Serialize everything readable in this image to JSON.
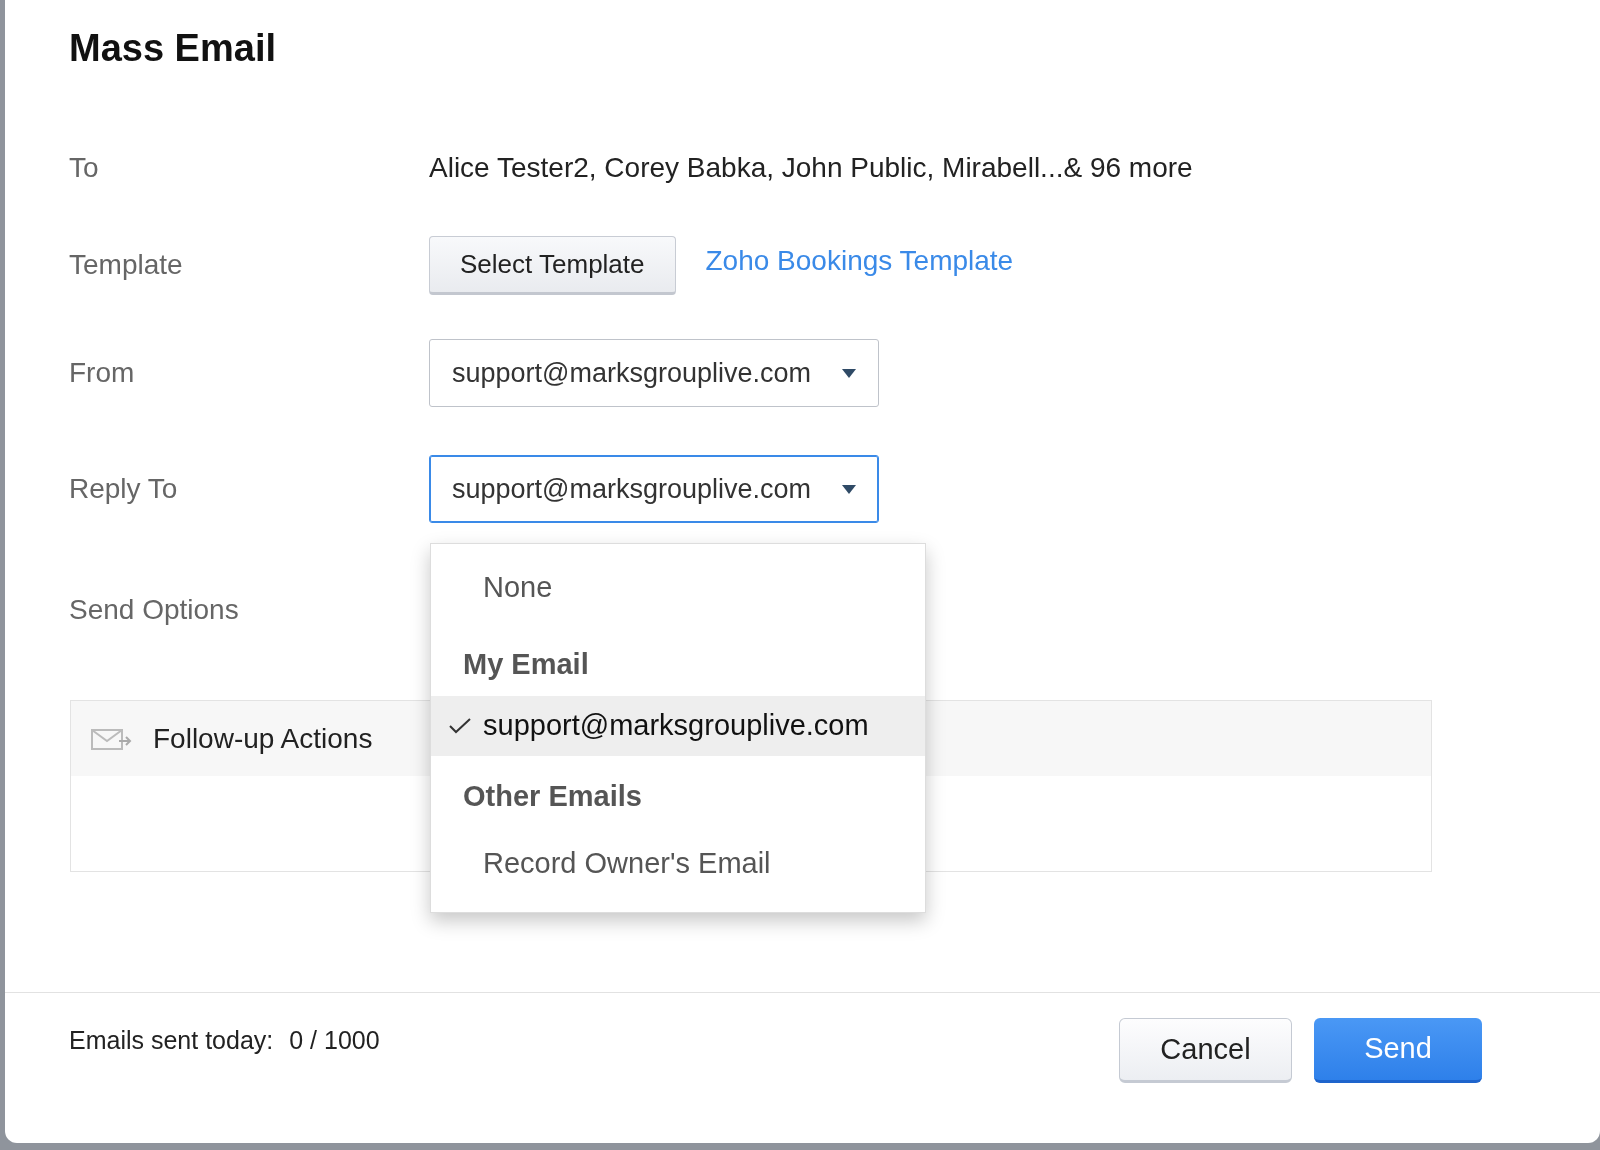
{
  "dialog": {
    "title": "Mass Email"
  },
  "fields": [
    {
      "kind": "text",
      "label": "To",
      "value": "Alice Tester2, Corey Babka, John Public, Mirabell...& 96 more"
    },
    {
      "kind": "template",
      "label": "Template",
      "button": "Select Template",
      "link": "Zoho Bookings Template"
    },
    {
      "kind": "select",
      "label": "From",
      "value": "support@marksgrouplive.com",
      "focused": false
    },
    {
      "kind": "select",
      "label": "Reply To",
      "value": "support@marksgrouplive.com",
      "focused": true
    },
    {
      "kind": "empty",
      "label": "Send Options"
    }
  ],
  "dropdown": {
    "items": [
      {
        "kind": "option",
        "label": "None",
        "selected": false
      },
      {
        "kind": "header",
        "label": "My Email"
      },
      {
        "kind": "option",
        "label": "support@marksgrouplive.com",
        "selected": true
      },
      {
        "kind": "header",
        "label": "Other Emails"
      },
      {
        "kind": "option",
        "label": "Record Owner's Email",
        "selected": false
      }
    ]
  },
  "follow_up": {
    "title": "Follow-up Actions"
  },
  "footer": {
    "counter_label": "Emails sent today:",
    "counter_value": "0 / 1000",
    "buttons": [
      {
        "kind": "secondary",
        "label": "Cancel"
      },
      {
        "kind": "primary",
        "label": "Send"
      }
    ]
  }
}
